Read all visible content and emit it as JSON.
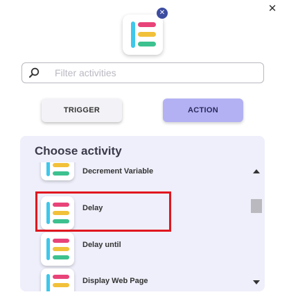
{
  "dialog": {
    "close_glyph": "✕",
    "remove_glyph": "✕"
  },
  "search": {
    "placeholder": "Filter activities",
    "value": ""
  },
  "toggle": {
    "trigger_label": "TRIGGER",
    "action_label": "ACTION",
    "selected": "ACTION"
  },
  "panel": {
    "title": "Choose activity",
    "items": [
      {
        "label": "Decrement Variable",
        "icon": "activity-logo-icon"
      },
      {
        "label": "Delay",
        "icon": "activity-logo-icon",
        "highlighted": true
      },
      {
        "label": "Delay until",
        "icon": "activity-logo-icon"
      },
      {
        "label": "Display Web Page",
        "icon": "activity-logo-icon"
      }
    ]
  },
  "colors": {
    "logo_blue": "#3ec7ea",
    "logo_pink": "#e84479",
    "logo_yellow": "#f2c13a",
    "logo_green": "#3cc18f",
    "accent_action": "#b3b1f3",
    "highlight": "#e0161e"
  }
}
